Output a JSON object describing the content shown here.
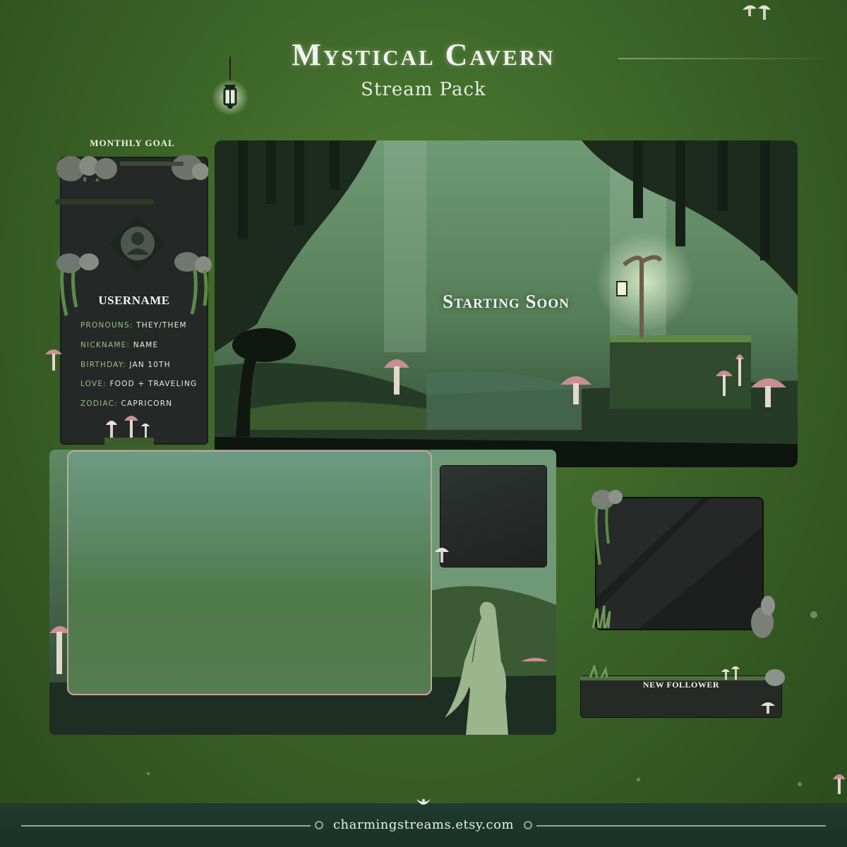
{
  "header": {
    "title": "Mystical Cavern",
    "subtitle": "Stream Pack"
  },
  "info_panel": {
    "goal_label": "MONTHLY GOAL",
    "username": "USERNAME",
    "rows": [
      {
        "key": "PRONOUNS:",
        "value": "THEY/THEM"
      },
      {
        "key": "NICKNAME:",
        "value": "NAME"
      },
      {
        "key": "BIRTHDAY:",
        "value": "JAN 10TH"
      },
      {
        "key": "LOVE:",
        "value": "FOOD + TRAVELING"
      },
      {
        "key": "ZODIAC:",
        "value": "CAPRICORN"
      }
    ]
  },
  "scene": {
    "label": "Starting Soon"
  },
  "alerts": {
    "new_follower": "NEW FOLLOWER"
  },
  "footer": {
    "url": "charmingstreams.etsy.com"
  },
  "colors": {
    "background": "#3c6528",
    "panel": "#242927",
    "accent_green": "#9cbb83",
    "mushroom_pink": "#c98e95",
    "footer": "#1f3a2f"
  }
}
